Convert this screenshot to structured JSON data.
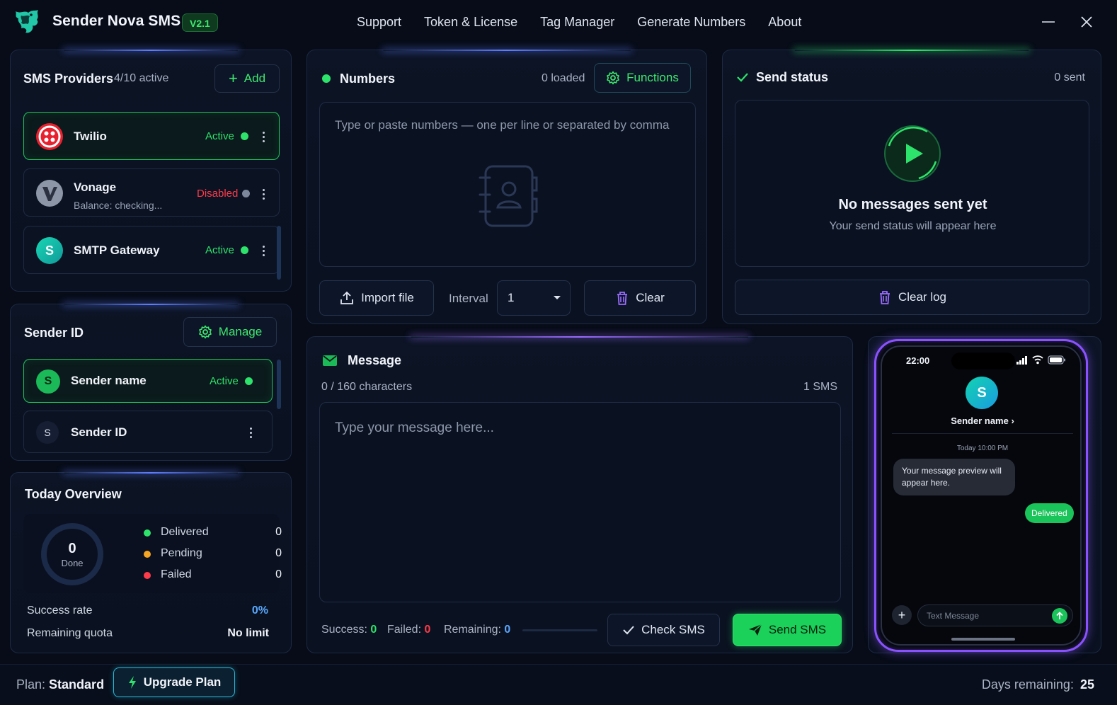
{
  "app": {
    "title": "Sender Nova SMS",
    "version": "V2.1",
    "nav": [
      "Support",
      "Token & License",
      "Tag Manager",
      "Generate Numbers",
      "About"
    ]
  },
  "providers": {
    "title": "SMS Providers",
    "count": "4/10 active",
    "add_label": "Add",
    "items": [
      {
        "name": "Twilio",
        "status": "Active",
        "sub": ""
      },
      {
        "name": "Vonage",
        "status": "Disabled",
        "sub": "Balance: checking..."
      },
      {
        "name": "SMTP Gateway",
        "status": "Active",
        "sub": "",
        "initial": "S"
      }
    ]
  },
  "sender": {
    "title": "Sender ID",
    "manage_label": "Manage",
    "items": [
      {
        "name": "Sender name",
        "status": "Active",
        "initial": "S"
      },
      {
        "name": "Sender ID",
        "status": "",
        "initial": "S"
      }
    ]
  },
  "overview": {
    "title": "Today Overview",
    "done_value": "0",
    "done_label": "Done",
    "legend": [
      {
        "name": "Delivered",
        "value": "0"
      },
      {
        "name": "Pending",
        "value": "0"
      },
      {
        "name": "Failed",
        "value": "0"
      }
    ],
    "success_rate_label": "Success rate",
    "success_rate_value": "0%",
    "quota_label": "Remaining quota",
    "quota_value": "No limit"
  },
  "numbers": {
    "title": "Numbers",
    "count": "0 loaded",
    "functions_label": "Functions",
    "placeholder": "Type or paste numbers — one per line or separated by comma",
    "import_label": "Import file",
    "interval_label": "Interval",
    "interval_value": "1",
    "clear_label": "Clear"
  },
  "send_status": {
    "title": "Send status",
    "count": "0 sent",
    "empty_title": "No messages sent yet",
    "empty_sub": "Your send status will appear here",
    "clear_log_label": "Clear log"
  },
  "message": {
    "title": "Message",
    "chars": "0 / 160 characters",
    "sms_count": "1 SMS",
    "placeholder": "Type your message here...",
    "success_label": "Success:",
    "success_value": "0",
    "failed_label": "Failed:",
    "failed_value": "0",
    "remaining_label": "Remaining:",
    "remaining_value": "0",
    "check_label": "Check SMS",
    "send_label": "Send SMS"
  },
  "phone": {
    "time": "22:00",
    "avatar": "S",
    "sender": "Sender name ›",
    "timestamp": "Today 10:00 PM",
    "bubble": "Your message preview will appear here.",
    "delivered": "Delivered",
    "input_placeholder": "Text Message"
  },
  "footer": {
    "plan_label": "Plan:",
    "plan_value": "Standard",
    "upgrade_label": "Upgrade Plan",
    "days_label": "Days remaining:",
    "days_value": "25"
  },
  "colors": {
    "accent_green": "#2ee36b",
    "danger_red": "#ff3b4a",
    "pending_orange": "#f5a524",
    "info_blue": "#5aa8ff",
    "phone_border": "#8a52ff"
  }
}
